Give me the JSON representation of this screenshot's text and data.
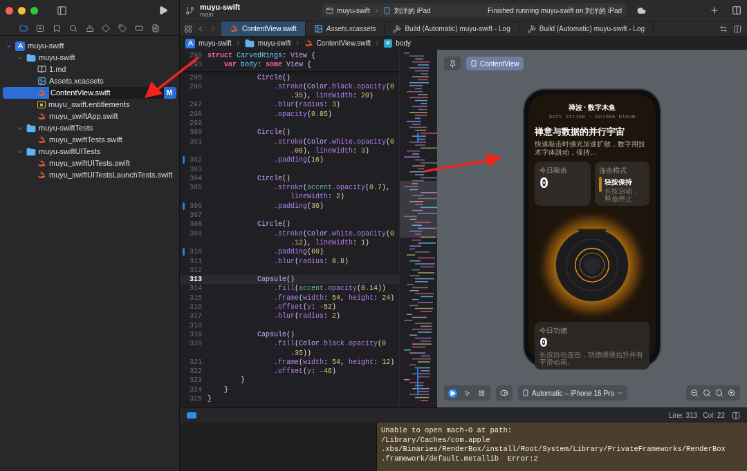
{
  "window": {
    "project": "muyu-swift",
    "branch": "main",
    "scheme": "muyu-swift",
    "device": "刘洋的 iPad",
    "status": "Finished running muyu-swift on 刘洋的 iPad"
  },
  "navigator_tabs": [
    {
      "kind": "files",
      "selected": true
    },
    {
      "kind": "source",
      "selected": false
    },
    {
      "kind": "bookmarks",
      "selected": false
    },
    {
      "kind": "find",
      "selected": false
    },
    {
      "kind": "issues",
      "selected": false
    },
    {
      "kind": "tests",
      "selected": false
    },
    {
      "kind": "debug",
      "selected": false
    },
    {
      "kind": "breakpoints",
      "selected": false
    },
    {
      "kind": "reports",
      "selected": false
    }
  ],
  "tree": [
    {
      "label": "muyu-swift",
      "kind": "project",
      "expanded": true,
      "selected": false,
      "children": [
        {
          "label": "muyu-swift",
          "kind": "folder",
          "expanded": true,
          "selected": false,
          "children": [
            {
              "label": "1.md",
              "kind": "doc",
              "selected": false
            },
            {
              "label": "Assets.xcassets",
              "kind": "assets",
              "selected": false
            },
            {
              "label": "ContentView.swift",
              "kind": "swift",
              "selected": true,
              "badge": "M"
            },
            {
              "label": "muyu_swift.entitlements",
              "kind": "entitlements",
              "selected": false
            },
            {
              "label": "muyu_swiftApp.swift",
              "kind": "swift",
              "selected": false
            }
          ]
        },
        {
          "label": "muyu-swiftTests",
          "kind": "folder",
          "expanded": true,
          "selected": false,
          "children": [
            {
              "label": "muyu_swiftTests.swift",
              "kind": "swift",
              "selected": false
            }
          ]
        },
        {
          "label": "muyu-swiftUITests",
          "kind": "folder",
          "expanded": true,
          "selected": false,
          "children": [
            {
              "label": "muyu_swiftUITests.swift",
              "kind": "swift",
              "selected": false
            },
            {
              "label": "muyu_swiftUITestsLaunchTests.swift",
              "kind": "swift",
              "selected": false
            }
          ]
        }
      ]
    }
  ],
  "tabs": [
    {
      "label": "ContentView.swift",
      "kind": "swift",
      "selected": true,
      "italic": false
    },
    {
      "label": "Assets.xcassets",
      "kind": "assets",
      "selected": false,
      "italic": true
    },
    {
      "label": "Build (Automatic) muyu-swift - Log",
      "kind": "log",
      "selected": false,
      "italic": false
    },
    {
      "label": "Build (Automatic) muyu-swift - Log",
      "kind": "log",
      "selected": false,
      "italic": false
    }
  ],
  "breadcrumb": [
    {
      "label": "muyu-swift",
      "kind": "project"
    },
    {
      "label": "muyu-swift",
      "kind": "folder"
    },
    {
      "label": "ContentView.swift",
      "kind": "swift"
    },
    {
      "label": "body",
      "kind": "property",
      "badge": "P"
    }
  ],
  "editor": {
    "sticky_lines": [
      {
        "number": "290",
        "rows": [
          {
            "tokens": [
              {
                "text": "struct",
                "kind": "keyword"
              },
              {
                "text": " CarvedRings",
                "kind": "declaration"
              },
              {
                "text": ":",
                "kind": "plain"
              },
              {
                "text": " View",
                "kind": "type"
              },
              {
                "text": " {",
                "kind": "plain"
              }
            ]
          }
        ]
      },
      {
        "number": "293",
        "rows": [
          {
            "tokens": [
              {
                "text": "    var",
                "kind": "keyword"
              },
              {
                "text": " body",
                "kind": "declaration"
              },
              {
                "text": ":",
                "kind": "plain"
              },
              {
                "text": " some",
                "kind": "keyword"
              },
              {
                "text": " View",
                "kind": "type"
              },
              {
                "text": " {",
                "kind": "plain"
              }
            ]
          }
        ]
      }
    ],
    "lines": [
      {
        "number": "295",
        "current": false,
        "changed": false,
        "rows": [
          {
            "tokens": [
              {
                "text": "            Circle",
                "kind": "type"
              },
              {
                "text": "()",
                "kind": "plain"
              }
            ]
          }
        ]
      },
      {
        "number": "296",
        "current": false,
        "changed": false,
        "rows": [
          {
            "tokens": [
              {
                "text": "                .stroke",
                "kind": "member"
              },
              {
                "text": "(",
                "kind": "plain"
              },
              {
                "text": "Color",
                "kind": "type"
              },
              {
                "text": ".black.opacity",
                "kind": "member"
              },
              {
                "text": "(",
                "kind": "plain"
              },
              {
                "text": "0",
                "kind": "number"
              }
            ]
          },
          {
            "tokens": [
              {
                "text": "                    .35",
                "kind": "number"
              },
              {
                "text": "), ",
                "kind": "plain"
              },
              {
                "text": "lineWidth",
                "kind": "member"
              },
              {
                "text": ": ",
                "kind": "plain"
              },
              {
                "text": "20",
                "kind": "number"
              },
              {
                "text": ")",
                "kind": "plain"
              }
            ]
          }
        ]
      },
      {
        "number": "297",
        "current": false,
        "changed": false,
        "rows": [
          {
            "tokens": [
              {
                "text": "                .blur",
                "kind": "member"
              },
              {
                "text": "(",
                "kind": "plain"
              },
              {
                "text": "radius",
                "kind": "member"
              },
              {
                "text": ": ",
                "kind": "plain"
              },
              {
                "text": "3",
                "kind": "number"
              },
              {
                "text": ")",
                "kind": "plain"
              }
            ]
          }
        ]
      },
      {
        "number": "298",
        "current": false,
        "changed": false,
        "rows": [
          {
            "tokens": [
              {
                "text": "                .opacity",
                "kind": "member"
              },
              {
                "text": "(",
                "kind": "plain"
              },
              {
                "text": "0.85",
                "kind": "number"
              },
              {
                "text": ")",
                "kind": "plain"
              }
            ]
          }
        ]
      },
      {
        "number": "299",
        "current": false,
        "changed": false
      },
      {
        "number": "300",
        "current": false,
        "changed": false,
        "rows": [
          {
            "tokens": [
              {
                "text": "            Circle",
                "kind": "type"
              },
              {
                "text": "()",
                "kind": "plain"
              }
            ]
          }
        ]
      },
      {
        "number": "301",
        "current": false,
        "changed": false,
        "rows": [
          {
            "tokens": [
              {
                "text": "                .stroke",
                "kind": "member"
              },
              {
                "text": "(",
                "kind": "plain"
              },
              {
                "text": "Color",
                "kind": "type"
              },
              {
                "text": ".white.opacity",
                "kind": "member"
              },
              {
                "text": "(",
                "kind": "plain"
              },
              {
                "text": "0",
                "kind": "number"
              }
            ]
          },
          {
            "tokens": [
              {
                "text": "                    .08",
                "kind": "number"
              },
              {
                "text": "), ",
                "kind": "plain"
              },
              {
                "text": "lineWidth",
                "kind": "member"
              },
              {
                "text": ": ",
                "kind": "plain"
              },
              {
                "text": "3",
                "kind": "number"
              },
              {
                "text": ")",
                "kind": "plain"
              }
            ]
          }
        ]
      },
      {
        "number": "302",
        "current": false,
        "changed": true,
        "rows": [
          {
            "tokens": [
              {
                "text": "                .padding",
                "kind": "member"
              },
              {
                "text": "(",
                "kind": "plain"
              },
              {
                "text": "16",
                "kind": "number"
              },
              {
                "text": ")",
                "kind": "plain"
              }
            ]
          }
        ]
      },
      {
        "number": "303",
        "current": false,
        "changed": false
      },
      {
        "number": "304",
        "current": false,
        "changed": false,
        "rows": [
          {
            "tokens": [
              {
                "text": "            Circle",
                "kind": "type"
              },
              {
                "text": "()",
                "kind": "plain"
              }
            ]
          }
        ]
      },
      {
        "number": "305",
        "current": false,
        "changed": false,
        "rows": [
          {
            "tokens": [
              {
                "text": "                .stroke",
                "kind": "member"
              },
              {
                "text": "(",
                "kind": "plain"
              },
              {
                "text": "accent",
                "kind": "local"
              },
              {
                "text": ".opacity",
                "kind": "member"
              },
              {
                "text": "(",
                "kind": "plain"
              },
              {
                "text": "0.7",
                "kind": "number"
              },
              {
                "text": "),",
                "kind": "plain"
              }
            ]
          },
          {
            "tokens": [
              {
                "text": "                    lineWidth",
                "kind": "member"
              },
              {
                "text": ": ",
                "kind": "plain"
              },
              {
                "text": "2",
                "kind": "number"
              },
              {
                "text": ")",
                "kind": "plain"
              }
            ]
          }
        ]
      },
      {
        "number": "306",
        "current": false,
        "changed": true,
        "rows": [
          {
            "tokens": [
              {
                "text": "                .padding",
                "kind": "member"
              },
              {
                "text": "(",
                "kind": "plain"
              },
              {
                "text": "36",
                "kind": "number"
              },
              {
                "text": ")",
                "kind": "plain"
              }
            ]
          }
        ]
      },
      {
        "number": "307",
        "current": false,
        "changed": false
      },
      {
        "number": "308",
        "current": false,
        "changed": false,
        "rows": [
          {
            "tokens": [
              {
                "text": "            Circle",
                "kind": "type"
              },
              {
                "text": "()",
                "kind": "plain"
              }
            ]
          }
        ]
      },
      {
        "number": "309",
        "current": false,
        "changed": false,
        "rows": [
          {
            "tokens": [
              {
                "text": "                .stroke",
                "kind": "member"
              },
              {
                "text": "(",
                "kind": "plain"
              },
              {
                "text": "Color",
                "kind": "type"
              },
              {
                "text": ".white.opacity",
                "kind": "member"
              },
              {
                "text": "(",
                "kind": "plain"
              },
              {
                "text": "0",
                "kind": "number"
              }
            ]
          },
          {
            "tokens": [
              {
                "text": "                    .12",
                "kind": "number"
              },
              {
                "text": "), ",
                "kind": "plain"
              },
              {
                "text": "lineWidth",
                "kind": "member"
              },
              {
                "text": ": ",
                "kind": "plain"
              },
              {
                "text": "1",
                "kind": "number"
              },
              {
                "text": ")",
                "kind": "plain"
              }
            ]
          }
        ]
      },
      {
        "number": "310",
        "current": false,
        "changed": true,
        "rows": [
          {
            "tokens": [
              {
                "text": "                .padding",
                "kind": "member"
              },
              {
                "text": "(",
                "kind": "plain"
              },
              {
                "text": "60",
                "kind": "number"
              },
              {
                "text": ")",
                "kind": "plain"
              }
            ]
          }
        ]
      },
      {
        "number": "311",
        "current": false,
        "changed": false,
        "rows": [
          {
            "tokens": [
              {
                "text": "                .blur",
                "kind": "member"
              },
              {
                "text": "(",
                "kind": "plain"
              },
              {
                "text": "radius",
                "kind": "member"
              },
              {
                "text": ": ",
                "kind": "plain"
              },
              {
                "text": "0.8",
                "kind": "number"
              },
              {
                "text": ")",
                "kind": "plain"
              }
            ]
          }
        ]
      },
      {
        "number": "312",
        "current": false,
        "changed": false
      },
      {
        "number": "313",
        "current": true,
        "changed": false,
        "rows": [
          {
            "tokens": [
              {
                "text": "            Capsule",
                "kind": "type"
              },
              {
                "text": "()",
                "kind": "plain"
              }
            ]
          }
        ]
      },
      {
        "number": "314",
        "current": false,
        "changed": false,
        "rows": [
          {
            "tokens": [
              {
                "text": "                .fill",
                "kind": "member"
              },
              {
                "text": "(",
                "kind": "plain"
              },
              {
                "text": "accent",
                "kind": "local"
              },
              {
                "text": ".opacity",
                "kind": "member"
              },
              {
                "text": "(",
                "kind": "plain"
              },
              {
                "text": "0.14",
                "kind": "number"
              },
              {
                "text": "))",
                "kind": "plain"
              }
            ]
          }
        ]
      },
      {
        "number": "315",
        "current": false,
        "changed": false,
        "rows": [
          {
            "tokens": [
              {
                "text": "                .frame",
                "kind": "member"
              },
              {
                "text": "(",
                "kind": "plain"
              },
              {
                "text": "width",
                "kind": "member"
              },
              {
                "text": ": ",
                "kind": "plain"
              },
              {
                "text": "54",
                "kind": "number"
              },
              {
                "text": ", ",
                "kind": "plain"
              },
              {
                "text": "height",
                "kind": "member"
              },
              {
                "text": ": ",
                "kind": "plain"
              },
              {
                "text": "24",
                "kind": "number"
              },
              {
                "text": ")",
                "kind": "plain"
              }
            ]
          }
        ]
      },
      {
        "number": "316",
        "current": false,
        "changed": false,
        "rows": [
          {
            "tokens": [
              {
                "text": "                .offset",
                "kind": "member"
              },
              {
                "text": "(",
                "kind": "plain"
              },
              {
                "text": "y",
                "kind": "member"
              },
              {
                "text": ": ",
                "kind": "plain"
              },
              {
                "text": "-52",
                "kind": "number"
              },
              {
                "text": ")",
                "kind": "plain"
              }
            ]
          }
        ]
      },
      {
        "number": "317",
        "current": false,
        "changed": false,
        "rows": [
          {
            "tokens": [
              {
                "text": "                .blur",
                "kind": "member"
              },
              {
                "text": "(",
                "kind": "plain"
              },
              {
                "text": "radius",
                "kind": "member"
              },
              {
                "text": ": ",
                "kind": "plain"
              },
              {
                "text": "2",
                "kind": "number"
              },
              {
                "text": ")",
                "kind": "plain"
              }
            ]
          }
        ]
      },
      {
        "number": "318",
        "current": false,
        "changed": false
      },
      {
        "number": "319",
        "current": false,
        "changed": false,
        "rows": [
          {
            "tokens": [
              {
                "text": "            Capsule",
                "kind": "type"
              },
              {
                "text": "()",
                "kind": "plain"
              }
            ]
          }
        ]
      },
      {
        "number": "320",
        "current": false,
        "changed": false,
        "rows": [
          {
            "tokens": [
              {
                "text": "                .fill",
                "kind": "member"
              },
              {
                "text": "(",
                "kind": "plain"
              },
              {
                "text": "Color",
                "kind": "type"
              },
              {
                "text": ".black.opacity",
                "kind": "member"
              },
              {
                "text": "(",
                "kind": "plain"
              },
              {
                "text": "0",
                "kind": "number"
              }
            ]
          },
          {
            "tokens": [
              {
                "text": "                    .35",
                "kind": "number"
              },
              {
                "text": "))",
                "kind": "plain"
              }
            ]
          }
        ]
      },
      {
        "number": "321",
        "current": false,
        "changed": false,
        "rows": [
          {
            "tokens": [
              {
                "text": "                .frame",
                "kind": "member"
              },
              {
                "text": "(",
                "kind": "plain"
              },
              {
                "text": "width",
                "kind": "member"
              },
              {
                "text": ": ",
                "kind": "plain"
              },
              {
                "text": "54",
                "kind": "number"
              },
              {
                "text": ", ",
                "kind": "plain"
              },
              {
                "text": "height",
                "kind": "member"
              },
              {
                "text": ": ",
                "kind": "plain"
              },
              {
                "text": "12",
                "kind": "number"
              },
              {
                "text": ")",
                "kind": "plain"
              }
            ]
          }
        ]
      },
      {
        "number": "322",
        "current": false,
        "changed": false,
        "rows": [
          {
            "tokens": [
              {
                "text": "                .offset",
                "kind": "member"
              },
              {
                "text": "(",
                "kind": "plain"
              },
              {
                "text": "y",
                "kind": "member"
              },
              {
                "text": ": ",
                "kind": "plain"
              },
              {
                "text": "-46",
                "kind": "number"
              },
              {
                "text": ")",
                "kind": "plain"
              }
            ]
          }
        ]
      },
      {
        "number": "323",
        "current": false,
        "changed": false,
        "rows": [
          {
            "tokens": [
              {
                "text": "        }",
                "kind": "plain"
              }
            ]
          }
        ]
      },
      {
        "number": "324",
        "current": false,
        "changed": false,
        "rows": [
          {
            "tokens": [
              {
                "text": "    }",
                "kind": "plain"
              }
            ]
          }
        ]
      },
      {
        "number": "325",
        "current": false,
        "changed": false,
        "rows": [
          {
            "tokens": [
              {
                "text": "}",
                "kind": "plain"
              }
            ]
          }
        ]
      }
    ]
  },
  "preview": {
    "canvas_title": "ContentView",
    "device": "Automatic – iPhone 16 Pro",
    "modes": [
      {
        "kind": "live",
        "selected": true
      },
      {
        "kind": "select",
        "selected": false
      },
      {
        "kind": "variants",
        "selected": false
      }
    ],
    "app": {
      "title": "禅波 · 数字木鱼",
      "subtitle": "Soft strike · Golden bloom",
      "heading": "禅意与数据的并行宇宙",
      "description": "快速敲击时佛光加速扩散，数字用技术字体跳动，保持…",
      "strike_card": {
        "label": "今日敲击",
        "value": "0"
      },
      "mode_card": {
        "label": "连击模式",
        "mode": "轻按保持",
        "hint": "长按启动，释放停止"
      },
      "merit_card": {
        "label": "今日功德",
        "value": "0",
        "hint": "长按自动连击，功德缓缓抬升并有平滑动画。"
      }
    }
  },
  "status_bar": {
    "debug_area_on": true,
    "line": "Line: 313",
    "column": "Col: 22"
  },
  "console": {
    "lines": [
      "Unable to open mach-O at path:",
      "/Library/Caches/com.apple",
      ".xbs/Binaries/RenderBox/install/Root/System/Library/PrivateFrameworks/RenderBox",
      ".framework/default.metallib  Error:2"
    ]
  }
}
